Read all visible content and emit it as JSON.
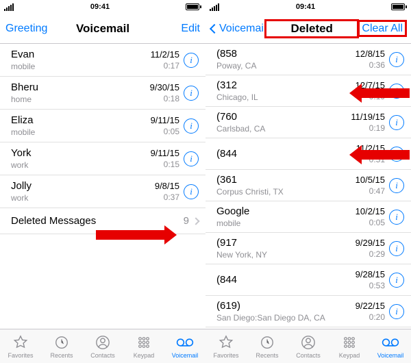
{
  "status": {
    "time": "09:41",
    "carrier": ""
  },
  "left": {
    "nav": {
      "left": "Greeting",
      "title": "Voicemail",
      "right": "Edit"
    },
    "rows": [
      {
        "name": "Evan",
        "sub": "mobile",
        "date": "11/2/15",
        "dur": "0:17"
      },
      {
        "name": "Bheru",
        "sub": "home",
        "date": "9/30/15",
        "dur": "0:18"
      },
      {
        "name": "Eliza",
        "sub": "mobile",
        "date": "9/11/15",
        "dur": "0:05"
      },
      {
        "name": "York",
        "sub": "work",
        "date": "9/11/15",
        "dur": "0:15"
      },
      {
        "name": "Jolly",
        "sub": "work",
        "date": "9/8/15",
        "dur": "0:37"
      }
    ],
    "deleted": {
      "label": "Deleted Messages",
      "count": "9"
    }
  },
  "right": {
    "nav": {
      "back": "Voicemail",
      "title": "Deleted",
      "right": "Clear All"
    },
    "rows": [
      {
        "name": "(858",
        "sub": "Poway, CA",
        "date": "12/8/15",
        "dur": "0:36"
      },
      {
        "name": "(312",
        "sub": "Chicago, IL",
        "date": "12/7/15",
        "dur": "0:19"
      },
      {
        "name": "(760",
        "sub": "Carlsbad, CA",
        "date": "11/19/15",
        "dur": "0:19"
      },
      {
        "name": "(844",
        "sub": "",
        "date": "11/2/15",
        "dur": "0:51"
      },
      {
        "name": "(361",
        "sub": "Corpus Christi, TX",
        "date": "10/5/15",
        "dur": "0:47"
      },
      {
        "name": "Google",
        "sub": "mobile",
        "date": "10/2/15",
        "dur": "0:05"
      },
      {
        "name": "(917",
        "sub": "New York, NY",
        "date": "9/29/15",
        "dur": "0:29"
      },
      {
        "name": "(844",
        "sub": "",
        "date": "9/28/15",
        "dur": "0:53"
      },
      {
        "name": "(619)",
        "sub": "San Diego:San Diego DA, CA",
        "date": "9/22/15",
        "dur": "0:20"
      }
    ]
  },
  "tabs": {
    "favorites": "Favorites",
    "recents": "Recents",
    "contacts": "Contacts",
    "keypad": "Keypad",
    "voicemail": "Voicemail"
  },
  "info_glyph": "i"
}
